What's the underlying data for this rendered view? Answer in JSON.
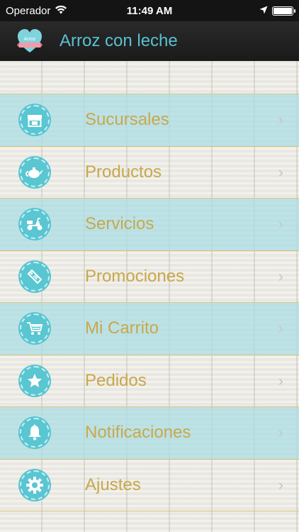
{
  "status_bar": {
    "carrier": "Operador",
    "time": "11:49 AM",
    "battery_level": 1.0
  },
  "nav": {
    "title": "Arroz con leche",
    "logo_text": "Arroz"
  },
  "menu": {
    "items": [
      {
        "label": "Sucursales",
        "icon": "store-icon"
      },
      {
        "label": "Productos",
        "icon": "teapot-icon"
      },
      {
        "label": "Servicios",
        "icon": "scooter-icon"
      },
      {
        "label": "Promociones",
        "icon": "tag-icon"
      },
      {
        "label": "Mi Carrito",
        "icon": "cart-icon"
      },
      {
        "label": "Pedidos",
        "icon": "star-icon"
      },
      {
        "label": "Notificaciones",
        "icon": "bell-icon"
      },
      {
        "label": "Ajustes",
        "icon": "gear-icon"
      }
    ]
  },
  "colors": {
    "accent": "#59c6d2",
    "label": "#c8a84a",
    "title": "#59c1cf",
    "row_highlight": "#a8dee4"
  }
}
